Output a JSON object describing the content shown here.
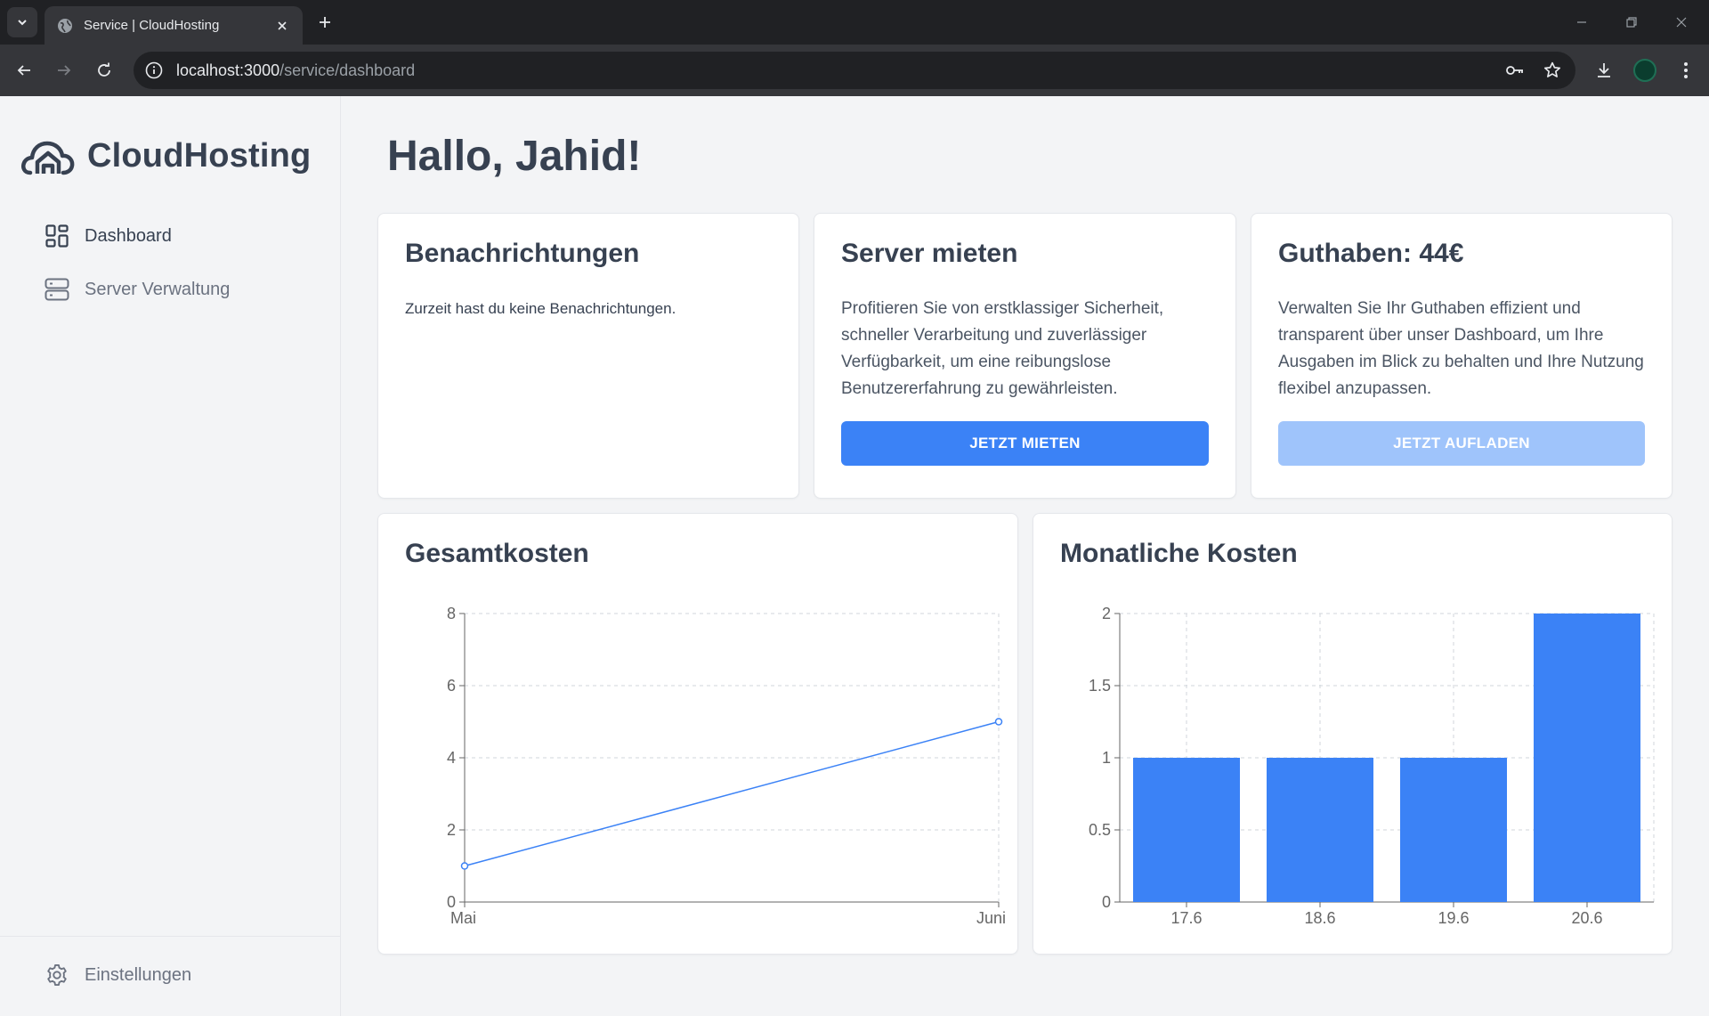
{
  "browser": {
    "tab_title": "Service | CloudHosting",
    "url_host": "localhost:3000",
    "url_path": "/service/dashboard"
  },
  "sidebar": {
    "brand": "CloudHosting",
    "items": [
      {
        "label": "Dashboard",
        "icon": "dashboard-grid-icon"
      },
      {
        "label": "Server Verwaltung",
        "icon": "server-stack-icon"
      }
    ],
    "settings_label": "Einstellungen"
  },
  "main": {
    "greeting": "Hallo, Jahid!",
    "notifications": {
      "title": "Benachrichtungen",
      "text": "Zurzeit hast du keine Benachrichtungen."
    },
    "rent": {
      "title": "Server mieten",
      "text": "Profitieren Sie von erstklassiger Sicherheit, schneller Verarbeitung und zuverlässiger Verfügbarkeit, um eine reibungslose Benutzererfahrung zu gewährleisten.",
      "button": "JETZT MIETEN"
    },
    "balance": {
      "title": "Guthaben: 44€",
      "text": "Verwalten Sie Ihr Guthaben effizient und transparent über unser Dashboard, um Ihre Ausgaben im Blick zu behalten und Ihre Nutzung flexibel anzupassen.",
      "button": "JETZT AUFLADEN"
    },
    "total_costs_title": "Gesamtkosten",
    "monthly_costs_title": "Monatliche Kosten"
  },
  "colors": {
    "accent": "#3b82f6",
    "accent_disabled": "#9fc4fb"
  },
  "chart_data": [
    {
      "type": "line",
      "title": "Gesamtkosten",
      "x": [
        "Mai",
        "Juni"
      ],
      "series": [
        {
          "values": [
            1,
            5
          ]
        }
      ],
      "ylim": [
        0,
        8
      ],
      "yticks": [
        0,
        2,
        4,
        6,
        8
      ],
      "grid": true
    },
    {
      "type": "bar",
      "title": "Monatliche Kosten",
      "categories": [
        "17.6",
        "18.6",
        "19.6",
        "20.6"
      ],
      "values": [
        1,
        1,
        1,
        2
      ],
      "ylim": [
        0,
        2
      ],
      "yticks": [
        0,
        0.5,
        1,
        1.5,
        2
      ],
      "grid": true
    }
  ]
}
